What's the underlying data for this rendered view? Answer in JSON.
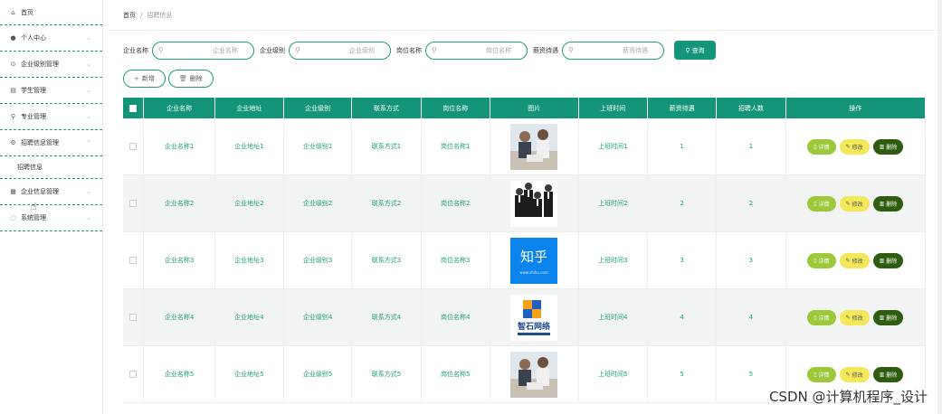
{
  "sidebar": {
    "items": [
      {
        "label": "首页",
        "icon": "home-icon",
        "glyph": "⌂"
      },
      {
        "label": "个人中心",
        "icon": "user-icon",
        "glyph": "👤"
      },
      {
        "label": "企业级别管理",
        "icon": "settings-icon",
        "glyph": "⚙"
      },
      {
        "label": "学生管理",
        "icon": "table-icon",
        "glyph": "▤"
      },
      {
        "label": "专业管理",
        "icon": "mic-icon",
        "glyph": "♙"
      },
      {
        "label": "招聘信息管理",
        "icon": "gear-icon",
        "glyph": "⚙"
      },
      {
        "label": "企业信息管理",
        "icon": "grid-icon",
        "glyph": "▦"
      },
      {
        "label": "系统管理",
        "icon": "power-icon",
        "glyph": "◌"
      }
    ],
    "submenu_label": "招聘信息"
  },
  "breadcrumb": {
    "home": "首页",
    "sep": "/",
    "current": "招聘信息"
  },
  "search": {
    "fields": [
      {
        "label": "企业名称",
        "placeholder": "企业名称"
      },
      {
        "label": "企业级别",
        "placeholder": "企业级别"
      },
      {
        "label": "岗位名称",
        "placeholder": "岗位名称"
      },
      {
        "label": "薪资待遇",
        "placeholder": "薪资待遇"
      }
    ],
    "button_label": "查询"
  },
  "actions": {
    "add_label": "新增",
    "delete_label": "删除"
  },
  "table": {
    "headers": [
      "企业名称",
      "企业地址",
      "企业级别",
      "联系方式",
      "岗位名称",
      "图片",
      "上班时间",
      "薪资待遇",
      "招聘人数",
      "操作"
    ],
    "rows": [
      {
        "name": "企业名称1",
        "addr": "企业地址1",
        "level": "企业级别1",
        "contact": "联系方式1",
        "job": "岗位名称1",
        "image": "office-meeting",
        "time": "上班时间1",
        "salary": "1",
        "count": "1"
      },
      {
        "name": "企业名称2",
        "addr": "企业地址2",
        "level": "企业级别2",
        "contact": "联系方式2",
        "job": "岗位名称2",
        "image": "business-people",
        "time": "上班时间2",
        "salary": "2",
        "count": "2"
      },
      {
        "name": "企业名称3",
        "addr": "企业地址3",
        "level": "企业级别3",
        "contact": "联系方式3",
        "job": "岗位名称3",
        "image": "zhihu-logo",
        "time": "上班时间3",
        "salary": "3",
        "count": "3"
      },
      {
        "name": "企业名称4",
        "addr": "企业地址4",
        "level": "企业级别4",
        "contact": "联系方式4",
        "job": "岗位名称4",
        "image": "company-logo",
        "time": "上班时间4",
        "salary": "4",
        "count": "4"
      },
      {
        "name": "企业名称5",
        "addr": "企业地址5",
        "level": "企业级别5",
        "contact": "联系方式5",
        "job": "岗位名称5",
        "image": "office-meeting",
        "time": "上班时间5",
        "salary": "5",
        "count": "5"
      }
    ],
    "op_labels": {
      "detail": "详情",
      "edit": "修改",
      "delete": "删除"
    }
  },
  "images": {
    "zhihu_text": "知乎",
    "zhihu_sub": "www.zhihu.com",
    "company_text": "智石网络"
  },
  "watermark": "CSDN @计算机程序_设计",
  "colors": {
    "accent": "#14957a",
    "detail": "#9cc83a",
    "edit": "#f2e85a",
    "delete": "#2f5c0e"
  }
}
